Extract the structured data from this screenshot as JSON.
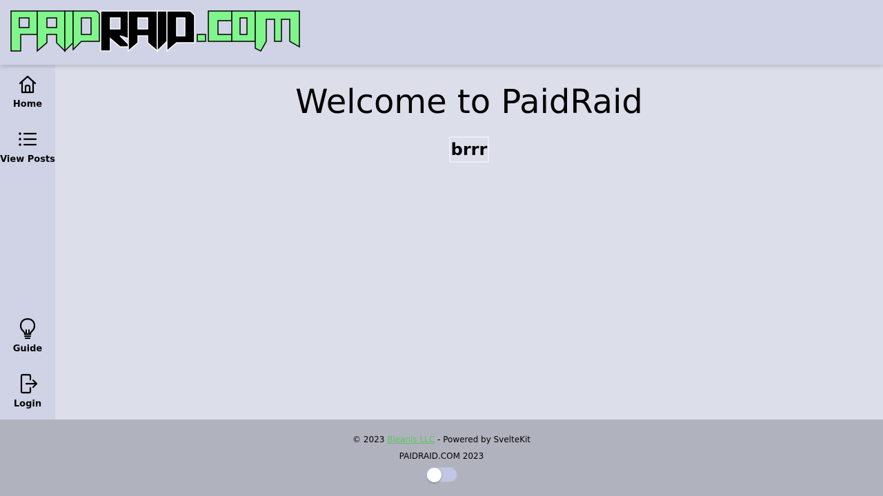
{
  "header": {
    "logo_text": "PAIDRAID.COM",
    "logo_colors": {
      "green": "#7ff58c",
      "black": "#000000"
    }
  },
  "sidebar": {
    "items": [
      {
        "label": "Home",
        "icon": "home-icon"
      },
      {
        "label": "View Posts",
        "icon": "list-icon"
      },
      {
        "label": "Guide",
        "icon": "lightbulb-icon"
      },
      {
        "label": "Login",
        "icon": "login-icon"
      }
    ]
  },
  "main": {
    "title": "Welcome to PaidRaid",
    "subtitle": "brrr"
  },
  "footer": {
    "copyright_prefix": "© 2023 ",
    "company_link": "Bleanis LLC",
    "powered_by": " - Powered by SvelteKit",
    "site_line": "PAIDRAID.COM 2023",
    "theme_toggle_on": false
  },
  "colors": {
    "header_bg": "#d0d3e5",
    "main_bg": "#dcdeea",
    "footer_bg": "#b0b2be",
    "link": "#5cc45c"
  }
}
